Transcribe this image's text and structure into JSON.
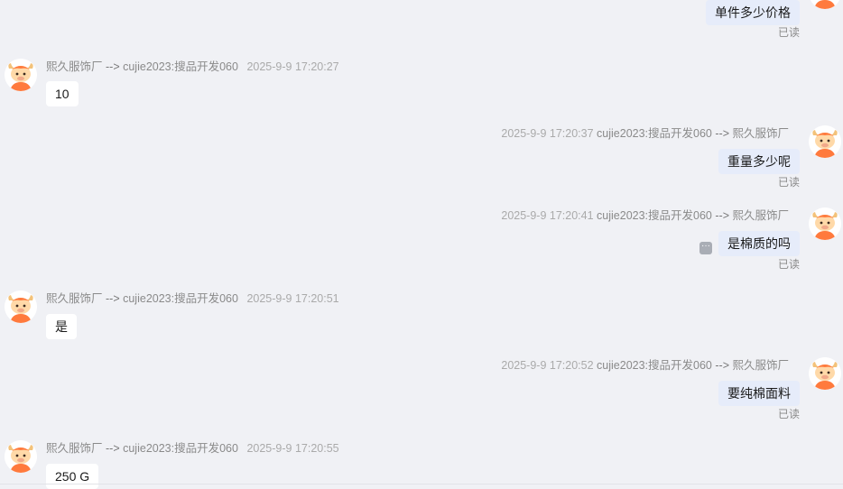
{
  "messages": [
    {
      "direction": "out",
      "text": "单件多少价格",
      "read": "已读"
    },
    {
      "direction": "in",
      "sender": "熙久服饰厂",
      "arrow": "-->",
      "recipient": "cujie2023:搜品开发060",
      "time": "2025-9-9 17:20:27",
      "text": "10"
    },
    {
      "direction": "out",
      "time": "2025-9-9 17:20:37",
      "sender": "cujie2023:搜品开发060",
      "arrow": "-->",
      "recipient": "熙久服饰厂",
      "text": "重量多少呢",
      "read": "已读"
    },
    {
      "direction": "out",
      "time": "2025-9-9 17:20:41",
      "sender": "cujie2023:搜品开发060",
      "arrow": "-->",
      "recipient": "熙久服饰厂",
      "text": "是棉质的吗",
      "read": "已读",
      "more_icon": "ellipsis-icon"
    },
    {
      "direction": "in",
      "sender": "熙久服饰厂",
      "arrow": "-->",
      "recipient": "cujie2023:搜品开发060",
      "time": "2025-9-9 17:20:51",
      "text": "是"
    },
    {
      "direction": "out",
      "time": "2025-9-9 17:20:52",
      "sender": "cujie2023:搜品开发060",
      "arrow": "-->",
      "recipient": "熙久服饰厂",
      "text": "要纯棉面料",
      "read": "已读"
    },
    {
      "direction": "in",
      "sender": "熙久服饰厂",
      "arrow": "-->",
      "recipient": "cujie2023:搜品开发060",
      "time": "2025-9-9 17:20:55",
      "text": "250 G"
    }
  ],
  "colors": {
    "background": "#f0f1f5",
    "bubble_in": "#ffffff",
    "bubble_out": "#e6ecfa",
    "avatar_accent": "#ff7a3d"
  },
  "icons": {
    "avatar": "cartoon-bull-avatar-icon"
  }
}
